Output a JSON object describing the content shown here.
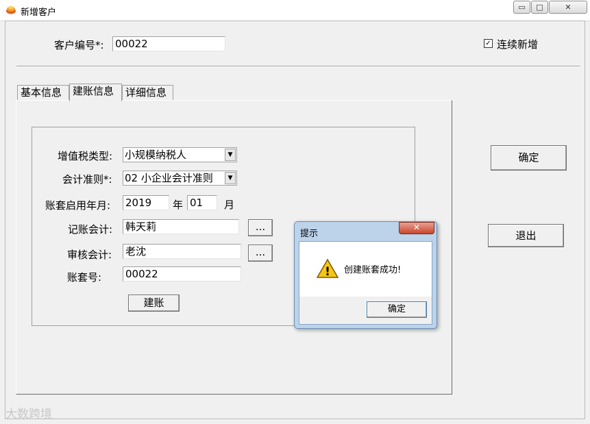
{
  "window": {
    "title": "新增客户",
    "controls": {
      "minimize": "▭",
      "maximize": "□",
      "close": "✕"
    }
  },
  "header": {
    "customer_code_label": "客户编号*:",
    "customer_code_value": "00022",
    "continuous_add_label": "连续新增",
    "continuous_add_checked": true,
    "check_mark": "✓"
  },
  "tabs": [
    {
      "label": "基本信息",
      "active": false
    },
    {
      "label": "建账信息",
      "active": true
    },
    {
      "label": "详细信息",
      "active": false
    }
  ],
  "form": {
    "vat_type_label": "增值税类型:",
    "vat_type_value": "小规模纳税人",
    "accounting_standard_label": "会计准则*:",
    "accounting_standard_value": "02 小企业会计准则",
    "start_date_label": "账套启用年月:",
    "year_value": "2019",
    "year_unit": "年",
    "month_value": "01",
    "month_unit": "月",
    "bookkeeper_label": "记账会计:",
    "bookkeeper_value": "韩天莉",
    "auditor_label": "审核会计:",
    "auditor_value": "老沈",
    "account_set_label": "账套号:",
    "account_set_value": "00022",
    "browse_label": "...",
    "create_button": "建账"
  },
  "side_buttons": {
    "confirm": "确定",
    "exit": "退出"
  },
  "dialog": {
    "title": "提示",
    "message": "创建账套成功!",
    "ok": "确定",
    "close": "✕",
    "warning_glyph": "!"
  },
  "watermark": "大数跨境",
  "icons": {
    "app": "app-logo-icon",
    "dropdown": "chevron-down-icon",
    "warning": "warning-icon"
  }
}
